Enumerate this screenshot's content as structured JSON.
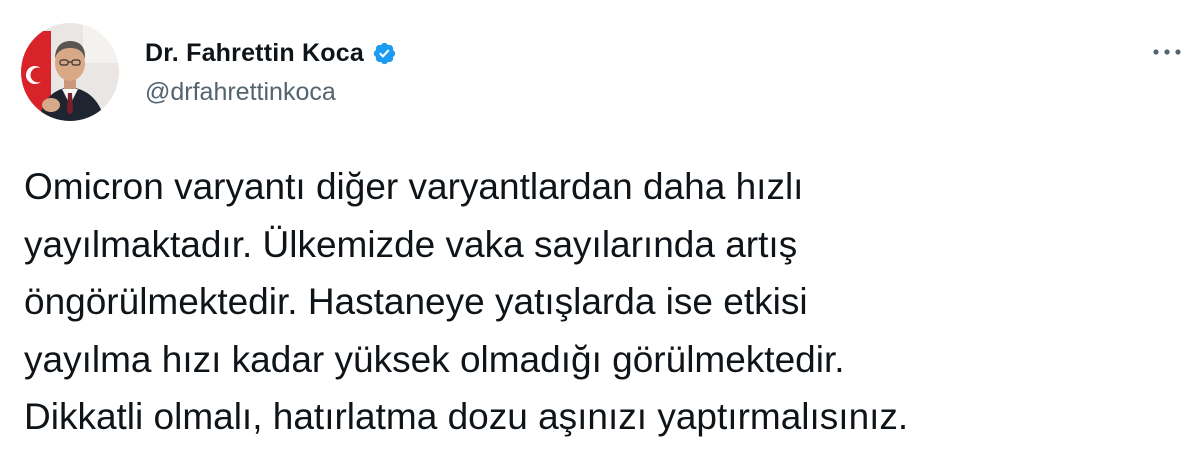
{
  "author": {
    "display_name": "Dr. Fahrettin Koca",
    "handle": "@drfahrettinkoca",
    "verified": true,
    "avatar_icon": "profile-photo"
  },
  "icons": {
    "verified": "verified-badge-icon",
    "more": "more-dots-icon"
  },
  "colors": {
    "verified_badge": "#1d9bf0",
    "handle_text": "#536471",
    "body_text": "#0f1419"
  },
  "tweet": {
    "lines": [
      "Omicron varyantı diğer varyantlardan daha hızlı",
      "yayılmaktadır. Ülkemizde vaka sayılarında artış",
      "öngörülmektedir. Hastaneye yatışlarda ise etkisi",
      "yayılma hızı kadar yüksek olmadığı görülmektedir.",
      "Dikkatli olmalı, hatırlatma dozu aşınızı yaptırmalısınız."
    ]
  }
}
